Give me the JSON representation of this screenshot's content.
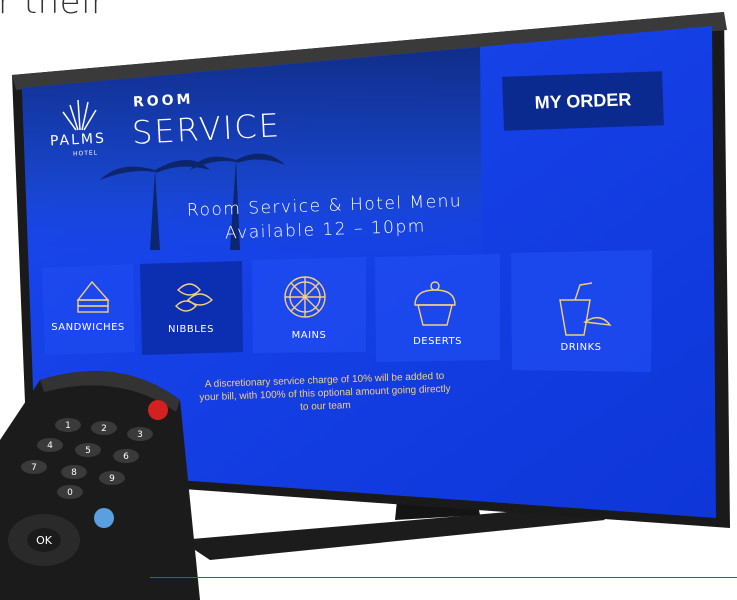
{
  "caption_fragment": "r their",
  "header": {
    "logo_name": "PALMS",
    "logo_sub": "HOTEL",
    "room": "ROOM",
    "service": "SERVICE",
    "my_order": "MY ORDER"
  },
  "menu": {
    "title_line1": "Room Service & Hotel Menu",
    "title_line2": "Available 12 – 10pm"
  },
  "categories": [
    {
      "label": "SANDWICHES",
      "icon": "sandwich-icon"
    },
    {
      "label": "NIBBLES",
      "icon": "nibbles-icon"
    },
    {
      "label": "MAINS",
      "icon": "pizza-icon"
    },
    {
      "label": "DESERTS",
      "icon": "cupcake-icon"
    },
    {
      "label": "DRINKS",
      "icon": "drink-icon"
    }
  ],
  "notice": "A discretionary service charge of 10% will be added to your bill, with 100% of this optional amount going directly to our team",
  "remote": {
    "keys": [
      "1",
      "2",
      "3",
      "4",
      "5",
      "6",
      "7",
      "8",
      "9",
      "0"
    ],
    "ok": "OK"
  },
  "colors": {
    "screen_blue": "#1240e6",
    "order_button": "#0a2a8f",
    "gold": "#f5cf7a"
  }
}
